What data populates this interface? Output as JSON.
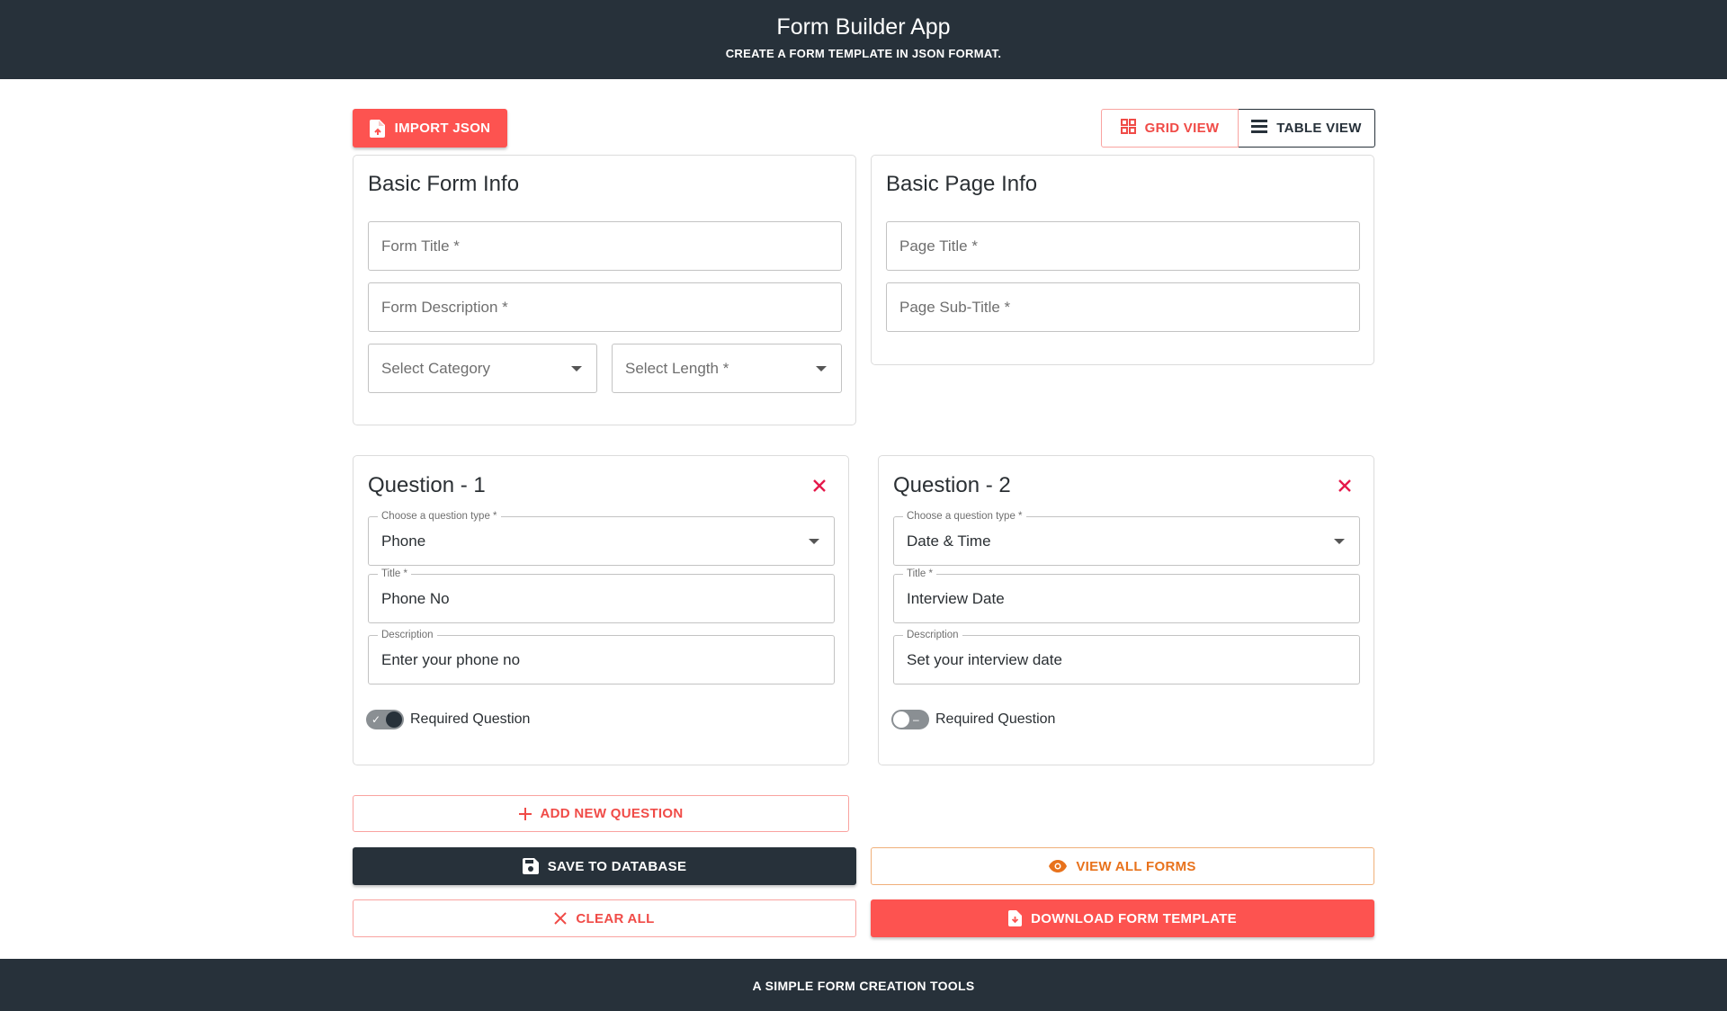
{
  "header": {
    "title": "Form Builder App",
    "subtitle": "CREATE A FORM TEMPLATE IN JSON FORMAT."
  },
  "toolbar": {
    "import_label": "IMPORT JSON",
    "grid_view_label": "GRID VIEW",
    "table_view_label": "TABLE VIEW",
    "active_view": "grid"
  },
  "basic_form_info": {
    "title": "Basic Form Info",
    "form_title_placeholder": "Form Title *",
    "form_description_placeholder": "Form Description *",
    "category_placeholder": "Select Category",
    "length_placeholder": "Select Length *"
  },
  "basic_page_info": {
    "title": "Basic Page Info",
    "page_title_placeholder": "Page Title *",
    "page_subtitle_placeholder": "Page Sub-Title *"
  },
  "questions": [
    {
      "heading": "Question - 1",
      "type_legend": "Choose a question type *",
      "type_value": "Phone",
      "title_legend": "Title *",
      "title_value": "Phone No",
      "description_legend": "Description",
      "description_value": "Enter your phone no",
      "required_label": "Required Question",
      "required": true
    },
    {
      "heading": "Question - 2",
      "type_legend": "Choose a question type *",
      "type_value": "Date & Time",
      "title_legend": "Title *",
      "title_value": "Interview Date",
      "description_legend": "Description",
      "description_value": "Set your interview date",
      "required_label": "Required Question",
      "required": false
    }
  ],
  "actions": {
    "add_question_label": "ADD NEW QUESTION",
    "save_label": "SAVE TO DATABASE",
    "view_forms_label": "VIEW ALL FORMS",
    "clear_label": "CLEAR ALL",
    "download_label": "DOWNLOAD FORM TEMPLATE"
  },
  "footer": {
    "text": "A SIMPLE FORM CREATION TOOLS"
  },
  "colors": {
    "header_bg": "#27313a",
    "accent_red": "#fd5350",
    "accent_orange": "#e8721c",
    "close_red": "#e5194b"
  },
  "icons": {
    "import": "file-import-icon",
    "grid": "grid-icon",
    "table": "table-rows-icon",
    "close": "close-icon",
    "add": "plus-icon",
    "save": "floppy-disk-icon",
    "view": "eye-icon",
    "clear": "close-icon",
    "download": "file-download-icon"
  }
}
